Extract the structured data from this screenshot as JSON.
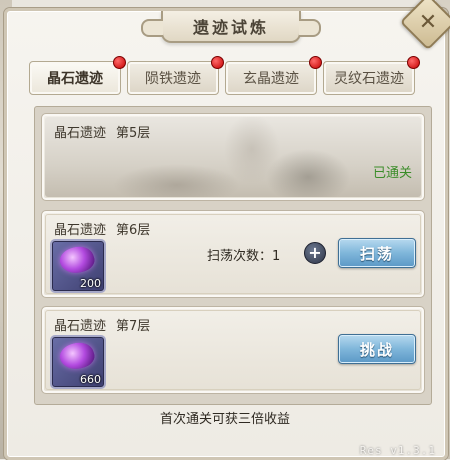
{
  "window": {
    "title": "遗迹试炼",
    "close_icon": "close-icon"
  },
  "tabs": [
    {
      "label": "晶石遗迹",
      "active": true,
      "badge": true
    },
    {
      "label": "陨铁遗迹",
      "active": false,
      "badge": true
    },
    {
      "label": "玄晶遗迹",
      "active": false,
      "badge": true
    },
    {
      "label": "灵纹石遗迹",
      "active": false,
      "badge": true
    }
  ],
  "levels": [
    {
      "name": "晶石遗迹",
      "floor": "第5层",
      "status": "已通关",
      "cleared": true
    },
    {
      "name": "晶石遗迹",
      "floor": "第6层",
      "reward_icon": "purple-crystal-icon",
      "reward_qty": "200",
      "sweep_label": "扫荡次数：1",
      "action_label": "扫荡"
    },
    {
      "name": "晶石遗迹",
      "floor": "第7层",
      "reward_icon": "purple-crystal-icon",
      "reward_qty": "660",
      "action_label": "挑战"
    }
  ],
  "footer_note": "首次通关可获三倍收益",
  "version": "Res v1.3.1",
  "colors": {
    "cleared": "#3c8d2a",
    "badge": "#c40000",
    "button": "#7fb6da"
  }
}
